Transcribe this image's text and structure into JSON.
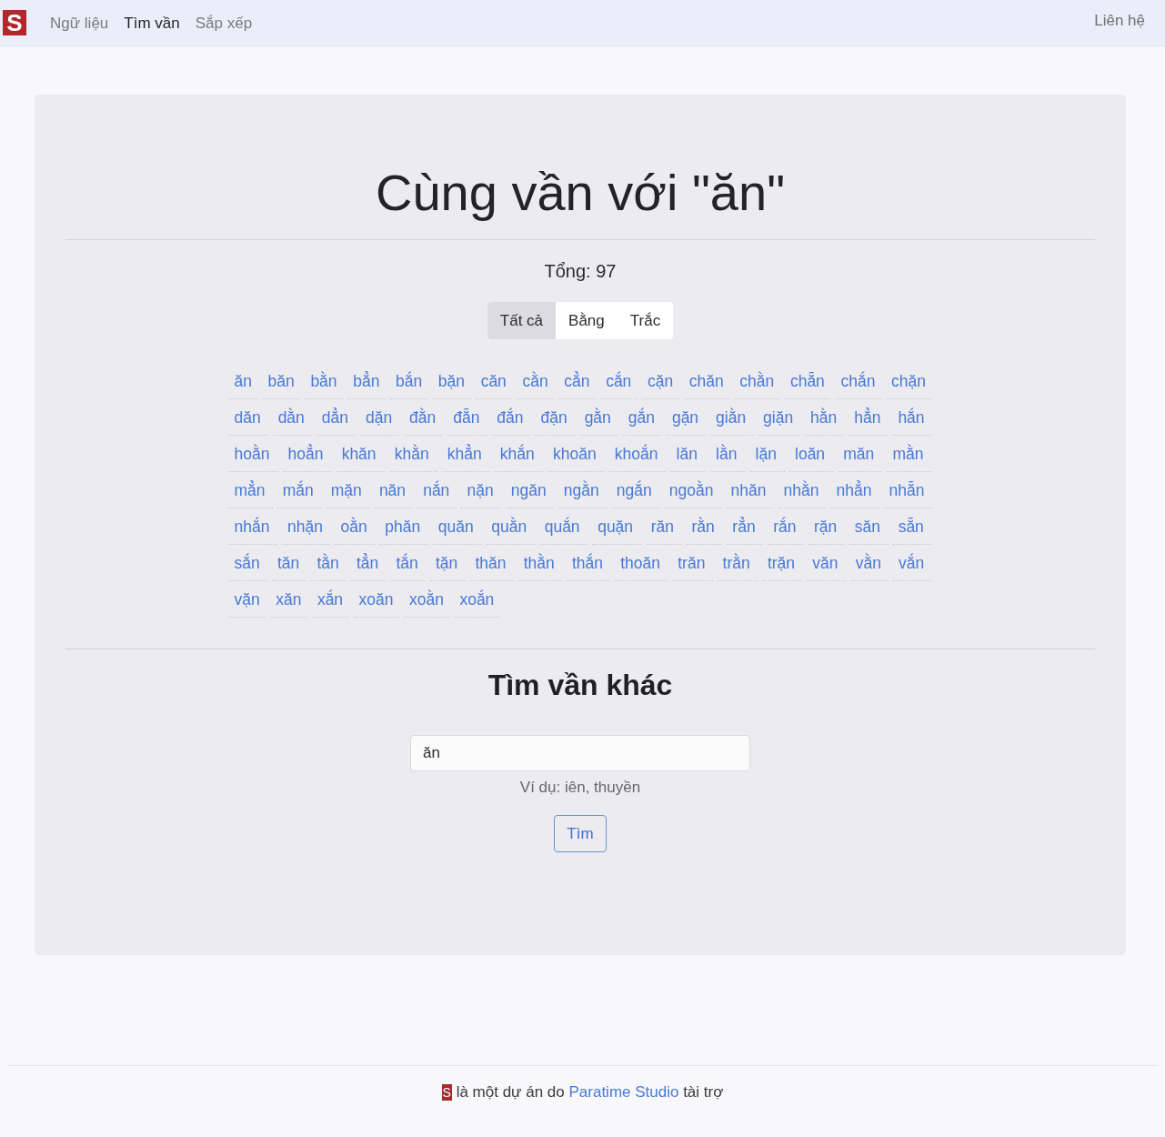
{
  "navbar": {
    "logo": "S",
    "items": [
      {
        "label": "Ngữ liệu",
        "selected": false
      },
      {
        "label": "Tìm vần",
        "selected": true
      },
      {
        "label": "Sắp xếp",
        "selected": false
      }
    ],
    "contact": "Liên hệ"
  },
  "results": {
    "title": "Cùng vần với \"ăn\"",
    "total": "Tổng: 97",
    "filters": [
      {
        "label": "Tất cả",
        "selected": true
      },
      {
        "label": "Bằng",
        "selected": false
      },
      {
        "label": "Trắc",
        "selected": false
      }
    ],
    "words": [
      "ăn",
      "băn",
      "bằn",
      "bẳn",
      "bắn",
      "bặn",
      "căn",
      "cằn",
      "cẳn",
      "cắn",
      "cặn",
      "chăn",
      "chằn",
      "chẵn",
      "chắn",
      "chặn",
      "dăn",
      "dằn",
      "dẳn",
      "dặn",
      "đằn",
      "đẵn",
      "đắn",
      "đặn",
      "gằn",
      "gắn",
      "gặn",
      "giằn",
      "giặn",
      "hằn",
      "hẳn",
      "hắn",
      "hoằn",
      "hoẳn",
      "khăn",
      "khằn",
      "khẳn",
      "khắn",
      "khoăn",
      "khoắn",
      "lăn",
      "lằn",
      "lặn",
      "loăn",
      "măn",
      "mằn",
      "mẳn",
      "mắn",
      "mặn",
      "năn",
      "nắn",
      "nặn",
      "ngăn",
      "ngằn",
      "ngắn",
      "ngoằn",
      "nhăn",
      "nhằn",
      "nhẳn",
      "nhẵn",
      "nhắn",
      "nhặn",
      "oằn",
      "phăn",
      "quăn",
      "quằn",
      "quắn",
      "quặn",
      "răn",
      "rằn",
      "rẳn",
      "rắn",
      "rặn",
      "săn",
      "sẵn",
      "sắn",
      "tăn",
      "tằn",
      "tẳn",
      "tắn",
      "tặn",
      "thăn",
      "thằn",
      "thắn",
      "thoăn",
      "trăn",
      "trằn",
      "trặn",
      "văn",
      "vằn",
      "vắn",
      "vặn",
      "xăn",
      "xắn",
      "xoăn",
      "xoằn",
      "xoắn"
    ]
  },
  "search": {
    "title": "Tìm vần khác",
    "input": {
      "value": "ăn"
    },
    "hint": "Ví dụ: iên, thuyền",
    "button": "Tìm"
  },
  "footer": {
    "logo": "S",
    "text_before": "là một dự án do",
    "link": "Paratime Studio",
    "text_after": "tài trợ"
  }
}
